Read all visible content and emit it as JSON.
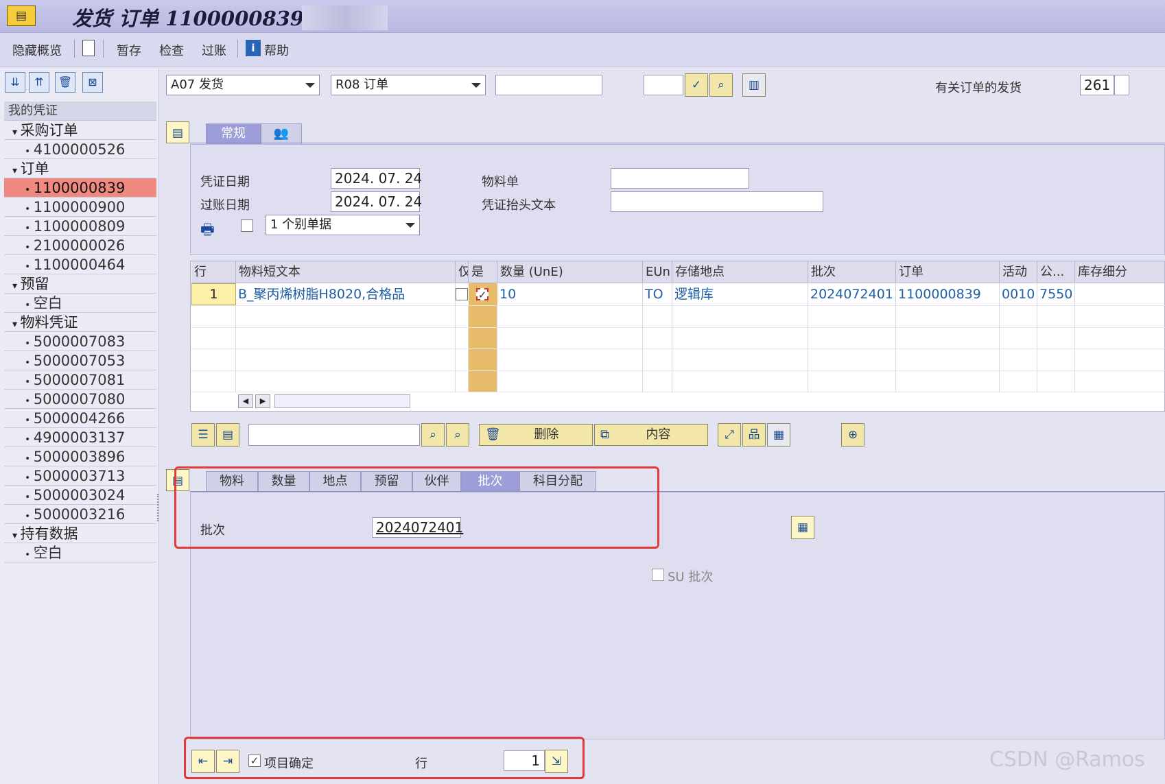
{
  "title": "发货 订单 1100000839 -",
  "toolbar": {
    "hide_overview": "隐藏概览",
    "save_temp": "暂存",
    "check": "检查",
    "post": "过账",
    "help": "帮助"
  },
  "tree": {
    "header": "我的凭证",
    "nodes": [
      {
        "label": "采购订单",
        "type": "folder"
      },
      {
        "label": "4100000526",
        "type": "item"
      },
      {
        "label": "订单",
        "type": "folder"
      },
      {
        "label": "1100000839",
        "type": "item",
        "selected": true
      },
      {
        "label": "1100000900",
        "type": "item"
      },
      {
        "label": "1100000809",
        "type": "item"
      },
      {
        "label": "2100000026",
        "type": "item"
      },
      {
        "label": "1100000464",
        "type": "item"
      },
      {
        "label": "预留",
        "type": "folder"
      },
      {
        "label": "空白",
        "type": "item"
      },
      {
        "label": "物料凭证",
        "type": "folder"
      },
      {
        "label": "5000007083",
        "type": "item"
      },
      {
        "label": "5000007053",
        "type": "item"
      },
      {
        "label": "5000007081",
        "type": "item"
      },
      {
        "label": "5000007080",
        "type": "item"
      },
      {
        "label": "5000004266",
        "type": "item"
      },
      {
        "label": "4900003137",
        "type": "item"
      },
      {
        "label": "5000003896",
        "type": "item"
      },
      {
        "label": "5000003713",
        "type": "item"
      },
      {
        "label": "5000003024",
        "type": "item"
      },
      {
        "label": "5000003216",
        "type": "item"
      },
      {
        "label": "持有数据",
        "type": "folder"
      },
      {
        "label": "空白",
        "type": "item"
      }
    ]
  },
  "header_bar": {
    "action": "A07 发货",
    "reference": "R08 订单",
    "movement_label": "有关订单的发货",
    "movement_type": "261"
  },
  "tabs_top": [
    "常规"
  ],
  "general": {
    "doc_date_label": "凭证日期",
    "doc_date": "2024. 07. 24",
    "post_date_label": "过账日期",
    "post_date": "2024. 07. 24",
    "material_slip_label": "物料单",
    "header_text_label": "凭证抬头文本",
    "print_option": "1 个别单据"
  },
  "grid": {
    "columns": [
      "行",
      "物料短文本",
      "仅",
      "是",
      "数量 (UnE)",
      "EUn",
      "存储地点",
      "批次",
      "订单",
      "活动",
      "公...",
      "库存细分"
    ],
    "row": {
      "line": "1",
      "text": "B_聚丙烯树脂H8020,合格品",
      "qty": "10",
      "unit": "TO",
      "sloc": "逻辑库",
      "batch": "2024072401",
      "order": "1100000839",
      "activity": "0010",
      "plant": "7550"
    }
  },
  "buttons": {
    "delete": "删除",
    "content": "内容"
  },
  "tabs_detail": [
    "物料",
    "数量",
    "地点",
    "预留",
    "伙伴",
    "批次",
    "科目分配"
  ],
  "detail": {
    "batch_label": "批次",
    "batch_value": "2024072401",
    "su_batch": "SU 批次"
  },
  "footer": {
    "item_ok": "项目确定",
    "line_label": "行",
    "line_value": "1"
  },
  "watermark": "CSDN @Ramos"
}
